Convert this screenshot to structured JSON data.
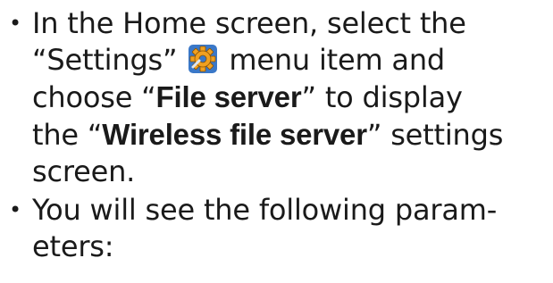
{
  "bullets": [
    {
      "marker": "•",
      "line1": "In the Home screen, select the",
      "line2_pre": "“Settings” ",
      "line2_post": " menu item and",
      "line3_pre": "choose “",
      "line3_bold": "File server",
      "line3_post": "” to display",
      "line4_pre": "the “",
      "line4_bold": "Wireless file server",
      "line4_post": "” settings",
      "line5": "screen.",
      "icon": "settings-gear-icon"
    },
    {
      "marker": "•",
      "line1": "You will see the following param-",
      "line2": "eters:"
    }
  ],
  "colors": {
    "text": "#1a1a1a",
    "icon_gear": "#f0a020",
    "icon_background": "#3a78c8"
  }
}
